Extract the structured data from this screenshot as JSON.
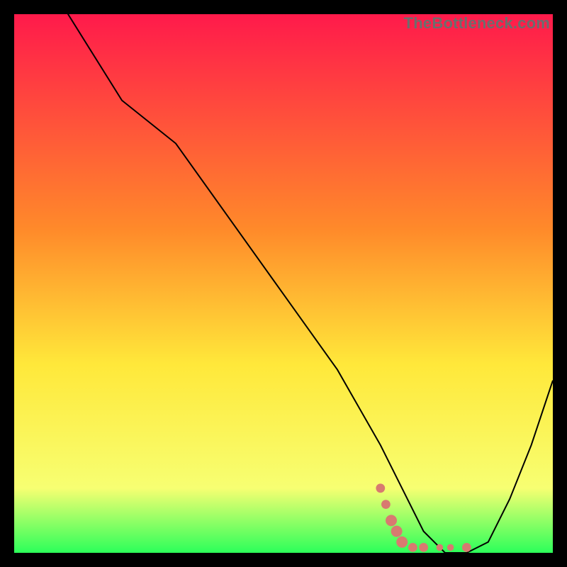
{
  "watermark": "TheBottleneck.com",
  "colors": {
    "gradient_top": "#ff1a4b",
    "gradient_mid1": "#ff8a2a",
    "gradient_mid2": "#ffe83a",
    "gradient_mid3": "#f7ff72",
    "gradient_bottom": "#2cff5a",
    "curve": "#000000",
    "marker": "#d87a70",
    "bg": "#000000"
  },
  "chart_data": {
    "type": "line",
    "title": "",
    "xlabel": "",
    "ylabel": "",
    "xlim": [
      0,
      100
    ],
    "ylim": [
      0,
      100
    ],
    "series": [
      {
        "name": "bottleneck-curve",
        "x": [
          0,
          10,
          20,
          30,
          40,
          50,
          60,
          68,
          72,
          76,
          80,
          84,
          88,
          92,
          96,
          100
        ],
        "y": [
          116,
          100,
          84,
          76,
          62,
          48,
          34,
          20,
          12,
          4,
          0,
          0,
          2,
          10,
          20,
          32
        ]
      }
    ],
    "markers": {
      "name": "optimal-region",
      "points": [
        {
          "x": 68,
          "y": 12,
          "r": 4
        },
        {
          "x": 69,
          "y": 9,
          "r": 4
        },
        {
          "x": 70,
          "y": 6,
          "r": 5
        },
        {
          "x": 71,
          "y": 4,
          "r": 5
        },
        {
          "x": 72,
          "y": 2,
          "r": 5
        },
        {
          "x": 74,
          "y": 1,
          "r": 4
        },
        {
          "x": 76,
          "y": 1,
          "r": 4
        },
        {
          "x": 79,
          "y": 1,
          "r": 3
        },
        {
          "x": 81,
          "y": 1,
          "r": 3
        },
        {
          "x": 84,
          "y": 1,
          "r": 4
        }
      ]
    }
  }
}
